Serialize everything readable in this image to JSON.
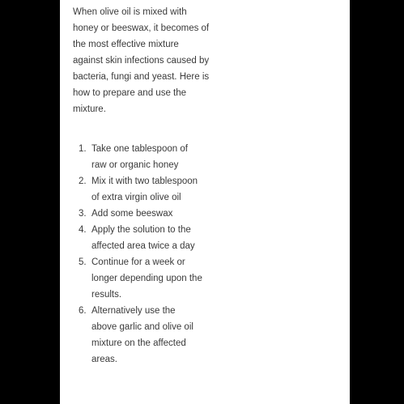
{
  "article": {
    "intro": "When olive oil is mixed with honey or beeswax, it becomes of the most effective mixture against skin infections caused by bacteria, fungi and yeast. Here is how to prepare and use the mixture.",
    "steps": [
      {
        "number": "1.",
        "text": "Take one tablespoon of raw or organic honey"
      },
      {
        "number": "2.",
        "text": "Mix it with two tablespoon of extra virgin olive oil"
      },
      {
        "number": "3.",
        "text": "Add some beeswax"
      },
      {
        "number": "4.",
        "text": "Apply the solution to the affected area twice a day"
      },
      {
        "number": "5.",
        "text": "Continue for a week or longer depending upon the results."
      },
      {
        "number": "6.",
        "text": "Alternatively use the above garlic and olive oil mixture on the affected areas."
      }
    ]
  }
}
